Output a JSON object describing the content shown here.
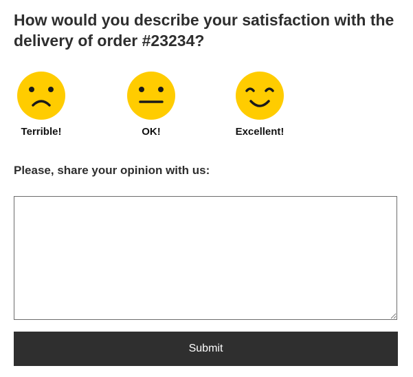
{
  "survey": {
    "question": "How would you describe your satisfaction with the delivery of order #23234?",
    "options": [
      {
        "label": "Terrible!",
        "icon": "frowning-face-icon"
      },
      {
        "label": "OK!",
        "icon": "neutral-face-icon"
      },
      {
        "label": "Excellent!",
        "icon": "smiling-face-icon"
      }
    ],
    "opinion_prompt": "Please, share your opinion with us:",
    "opinion_value": "",
    "submit_label": "Submit"
  },
  "colors": {
    "face": "#FFCC00",
    "face_features": "#1a1a1a",
    "submit_bg": "#2f2f2f",
    "text": "#2e2e2e"
  }
}
